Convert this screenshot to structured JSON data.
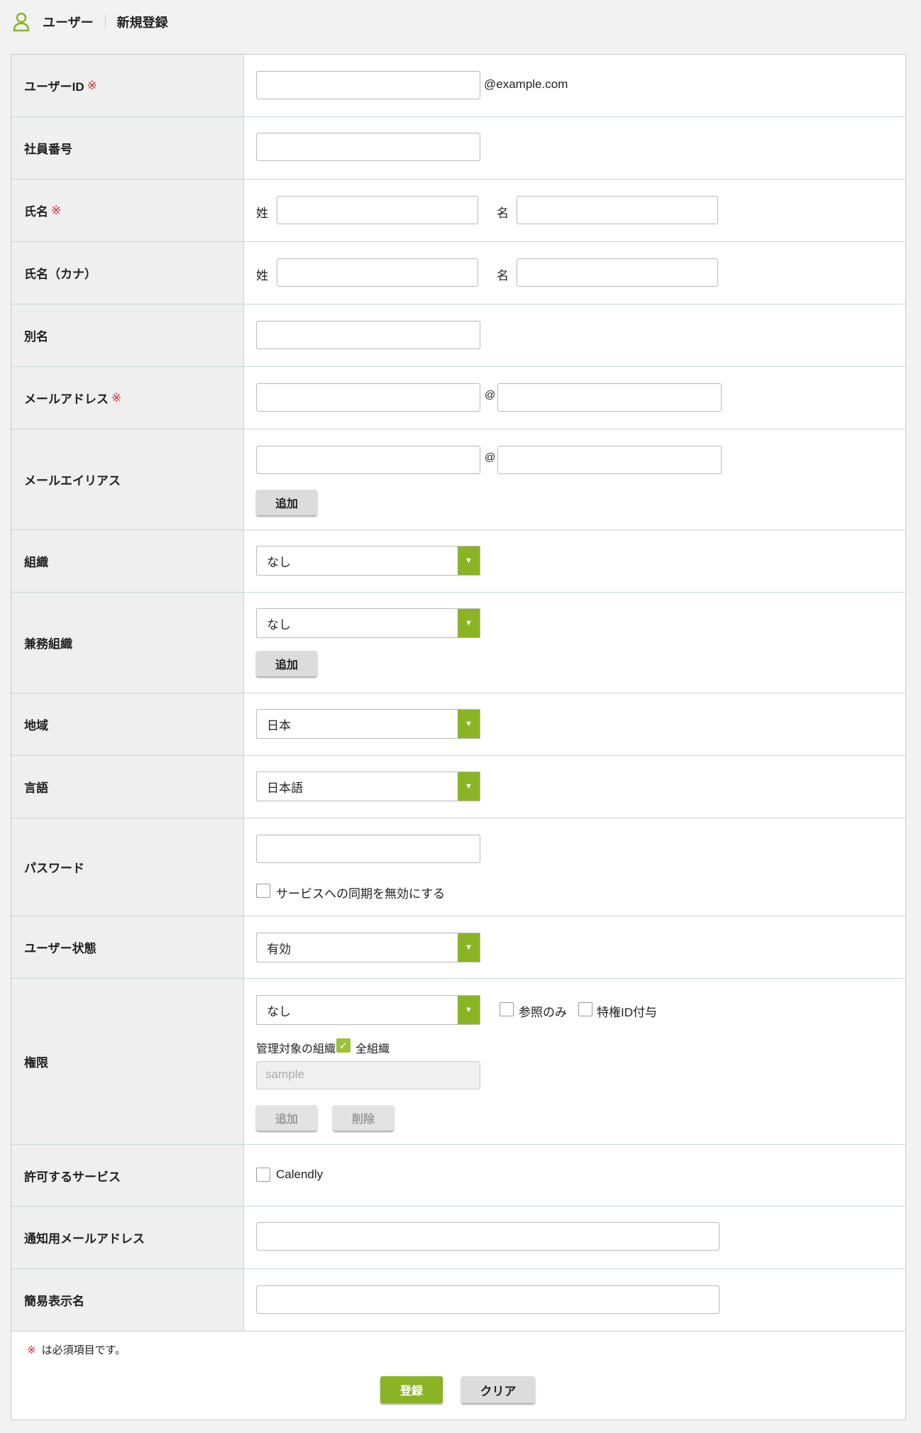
{
  "header": {
    "crumb1": "ユーザー",
    "crumb2": "新規登録",
    "icon": "user-icon",
    "accent": "#8ab424"
  },
  "fields": {
    "user_id": {
      "label": "ユーザーID",
      "suffix": "@example.com"
    },
    "employee_no": {
      "label": "社員番号"
    },
    "name": {
      "label": "氏名",
      "last": "姓",
      "first": "名"
    },
    "name_kana": {
      "label": "氏名（カナ）",
      "last": "姓",
      "first": "名"
    },
    "alias": {
      "label": "別名"
    },
    "email": {
      "label": "メールアドレス",
      "at": "@"
    },
    "email_alias": {
      "label": "メールエイリアス",
      "at": "@",
      "add": "追加"
    },
    "org": {
      "label": "組織",
      "value": "なし"
    },
    "sub_org": {
      "label": "兼務組織",
      "value": "なし",
      "add": "追加"
    },
    "region": {
      "label": "地域",
      "value": "日本"
    },
    "language": {
      "label": "言語",
      "value": "日本語"
    },
    "password": {
      "label": "パスワード",
      "sync_disable": "サービスへの同期を無効にする"
    },
    "status": {
      "label": "ユーザー状態",
      "value": "有効"
    },
    "authority": {
      "label": "権限",
      "value": "なし",
      "read_only": "参照のみ",
      "privileged_id": "特権ID付与",
      "managed_orgs": "管理対象の組織",
      "all_orgs": "全組織",
      "placeholder": "sample",
      "add": "追加",
      "delete": "削除"
    },
    "services": {
      "label": "許可するサービス",
      "service1": "Calendly"
    },
    "notify_email": {
      "label": "通知用メールアドレス"
    },
    "display_name": {
      "label": "簡易表示名"
    }
  },
  "required_mark": "※",
  "footnote": "は必須項目です。",
  "actions": {
    "submit": "登録",
    "clear": "クリア"
  }
}
